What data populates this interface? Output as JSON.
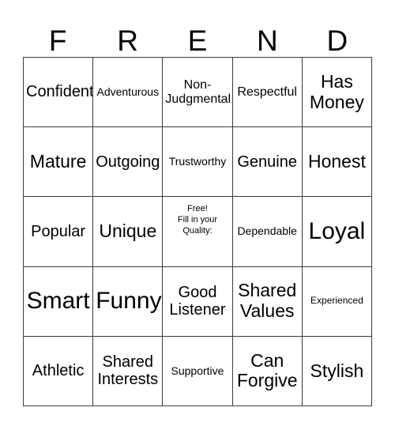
{
  "card": {
    "header": {
      "letters": [
        {
          "label": "F"
        },
        {
          "label": "R"
        },
        {
          "label": "E"
        },
        {
          "label": "N"
        },
        {
          "label": "D"
        }
      ]
    },
    "grid": {
      "rows": 5,
      "columns": 5,
      "border_color": "#3b3b3b",
      "background_color": "#ffffff",
      "text_color": "#000000",
      "cells": [
        {
          "text": "Confident",
          "size": "lg",
          "free": false
        },
        {
          "text": "Adventurous",
          "size": "sm",
          "free": false
        },
        {
          "text": "Non-\nJudgmental",
          "size": "md",
          "free": false
        },
        {
          "text": "Respectful",
          "size": "md",
          "free": false
        },
        {
          "text": "Has\nMoney",
          "size": "xl",
          "free": false
        },
        {
          "text": "Mature",
          "size": "xl",
          "free": false
        },
        {
          "text": "Outgoing",
          "size": "lg",
          "free": false
        },
        {
          "text": "Trustworthy",
          "size": "sm",
          "free": false
        },
        {
          "text": "Genuine",
          "size": "lg",
          "free": false
        },
        {
          "text": "Honest",
          "size": "xl",
          "free": false
        },
        {
          "text": "Popular",
          "size": "lg",
          "free": false
        },
        {
          "text": "Unique",
          "size": "xl",
          "free": false
        },
        {
          "text": "Free!\nFill in your\nQuality:",
          "size": "xs",
          "free": true
        },
        {
          "text": "Dependable",
          "size": "sm",
          "free": false
        },
        {
          "text": "Loyal",
          "size": "xxl",
          "free": false
        },
        {
          "text": "Smart",
          "size": "xxl",
          "free": false
        },
        {
          "text": "Funny",
          "size": "xxl",
          "free": false
        },
        {
          "text": "Good\nListener",
          "size": "lg",
          "free": false
        },
        {
          "text": "Shared\nValues",
          "size": "xl",
          "free": false
        },
        {
          "text": "Experienced",
          "size": "xs",
          "free": false
        },
        {
          "text": "Athletic",
          "size": "lg",
          "free": false
        },
        {
          "text": "Shared\nInterests",
          "size": "lg",
          "free": false
        },
        {
          "text": "Supportive",
          "size": "sm",
          "free": false
        },
        {
          "text": "Can\nForgive",
          "size": "xl",
          "free": false
        },
        {
          "text": "Stylish",
          "size": "xl",
          "free": false
        }
      ]
    }
  }
}
